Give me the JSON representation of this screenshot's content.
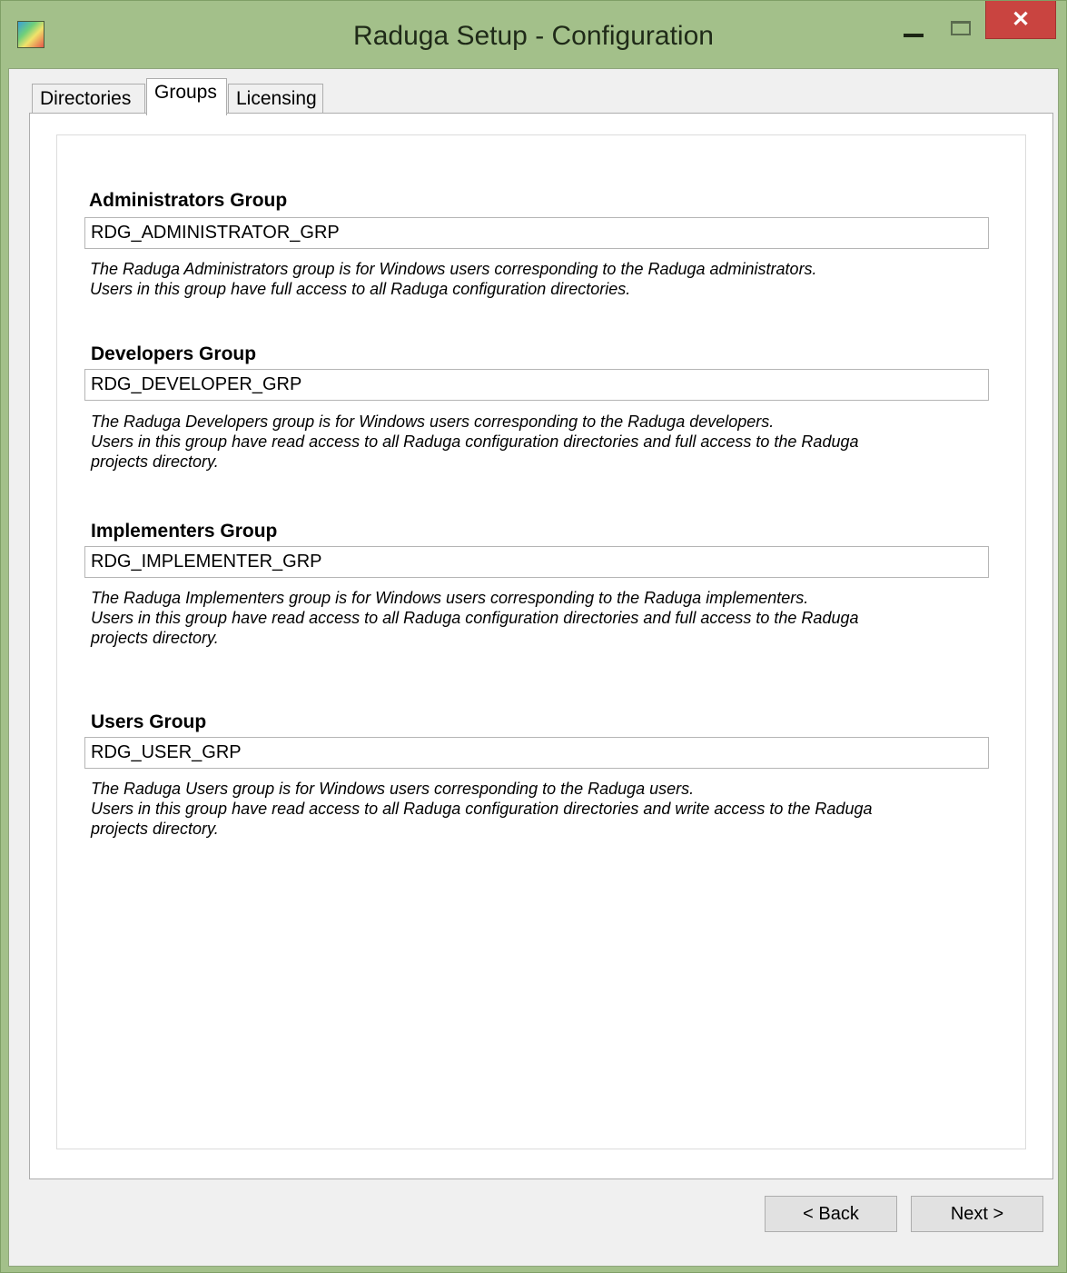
{
  "window": {
    "title": "Raduga Setup - Configuration",
    "close_glyph": "✕"
  },
  "tabs": [
    {
      "label": "Directories",
      "active": false
    },
    {
      "label": "Groups",
      "active": true
    },
    {
      "label": "Licensing",
      "active": false
    }
  ],
  "groups": [
    {
      "title": "Administrators Group",
      "value": "RDG_ADMINISTRATOR_GRP",
      "description": [
        "The Raduga Administrators group is for Windows users corresponding to the Raduga administrators.",
        "Users in this group have full access to all Raduga configuration directories."
      ]
    },
    {
      "title": "Developers Group",
      "value": "RDG_DEVELOPER_GRP",
      "description": [
        "The Raduga Developers group is for Windows users corresponding to the Raduga developers.",
        "Users in this group have read access to all Raduga configuration directories and full access to the Raduga",
        "projects directory."
      ]
    },
    {
      "title": "Implementers Group",
      "value": "RDG_IMPLEMENTER_GRP",
      "description": [
        "The Raduga Implementers group is for Windows users corresponding to the Raduga implementers.",
        "Users in this group have read access to all Raduga configuration directories and full access to the Raduga",
        "projects directory."
      ]
    },
    {
      "title": "Users Group",
      "value": "RDG_USER_GRP",
      "description": [
        "The Raduga Users group is for Windows users corresponding to the Raduga users.",
        "Users in this group have read access to all Raduga configuration directories and write access to the Raduga",
        "projects directory."
      ]
    }
  ],
  "buttons": {
    "back": "< Back",
    "next": "Next >"
  }
}
